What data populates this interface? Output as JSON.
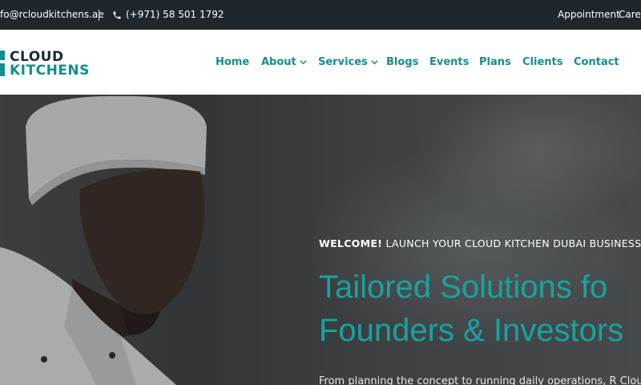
{
  "topbar": {
    "email": "fo@rcloudkitchens.ae",
    "phone": "(+971) 58 501 1792",
    "appointment": "Appointment",
    "careers": "Care"
  },
  "brand": {
    "line1": "CLOUD",
    "line2": "KITCHENS",
    "colors": {
      "dark": "#1a2a36",
      "teal": "#0f8f8e"
    }
  },
  "nav": {
    "items": [
      {
        "label": "Home"
      },
      {
        "label": "About"
      },
      {
        "label": "Services"
      },
      {
        "label": "Blogs"
      },
      {
        "label": "Events"
      },
      {
        "label": "Plans"
      },
      {
        "label": "Clients"
      },
      {
        "label": "Contact"
      }
    ],
    "color": "#148e8c"
  },
  "hero": {
    "welcome_bold": "WELCOME!",
    "welcome_rest": "LAUNCH YOUR CLOUD KITCHEN DUBAI BUSINESS WIT",
    "headline_line1": "Tailored Solutions fo",
    "headline_line2": "Founders & Investors",
    "description": "From planning the concept to running daily operations, R Cloud",
    "accent": "#17a3a0"
  }
}
